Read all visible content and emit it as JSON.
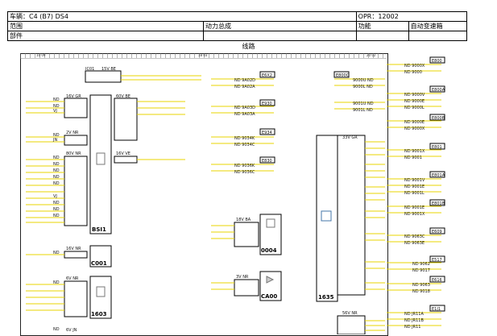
{
  "header": {
    "vehicle": "车辆：C4 (B7) DS4",
    "opr": "OPR：12002",
    "scope_label": "范围",
    "scope_value": "动力总成",
    "function_label": "功能",
    "function_value": "自动变速箱",
    "part_label": "部件"
  },
  "section_title": "线路",
  "ruler": [
    "10 09",
    "18 03",
    "20 02"
  ],
  "blocks": {
    "bsi1": "BSI1",
    "c001": "C001",
    "b1603": "1603",
    "b0004": "0004",
    "ca00": "CA00",
    "b1635": "1635"
  },
  "connectors": {
    "ic01": "IC01",
    "v15be": "15V BE",
    "v16gr": "16V GR",
    "v60be": "60V BE",
    "v2nr": "2V NR",
    "v80nr": "80V NR",
    "v16ve": "16V VE",
    "v16nr": "16V NR",
    "v6vnr": "6V NR",
    "v6vjn": "6V JN",
    "v18ba": "18V BA",
    "v3vnr": "3V NR",
    "v33gr": "33V GR",
    "v56nr": "56V NR"
  },
  "left_labels": [
    "ND",
    "ND",
    "VJ",
    "ND",
    "ND",
    "JN",
    "ND",
    "ND",
    "ND",
    "ND",
    "ND",
    "VJ",
    "ND",
    "ND",
    "ND",
    "ND",
    "ND"
  ],
  "middle_labels": [
    "ND 9A02D",
    "ND 9A02A",
    "ND 9A03D",
    "ND 9A03A",
    "ND 9034K",
    "ND 9034C",
    "ND 9036K",
    "ND 9036C"
  ],
  "right_labels": [
    "ND 9000X",
    "ND 9000",
    "9000U ND",
    "9000L ND",
    "ND 9000V",
    "ND 9000E",
    "ND 9000L",
    "9001U ND",
    "9001L ND",
    "ND 9000E",
    "ND 9000X",
    "ND 9001X",
    "ND 9001",
    "ND 9001V",
    "ND 9001E",
    "ND 9001L",
    "ND 9001E",
    "ND 9001X",
    "ND 9063C",
    "ND 9063E",
    "ND 9062",
    "ND 9017",
    "ND 9063",
    "ND 9018",
    "ND JR11A",
    "ND JR11B",
    "ND JR11"
  ],
  "tags": [
    "E800",
    "E800C",
    "E800A",
    "E800B",
    "E801",
    "E801A",
    "E801B",
    "E609",
    "E517",
    "E616",
    "E1J1",
    "E6X2",
    "E930",
    "E934",
    "E830"
  ]
}
